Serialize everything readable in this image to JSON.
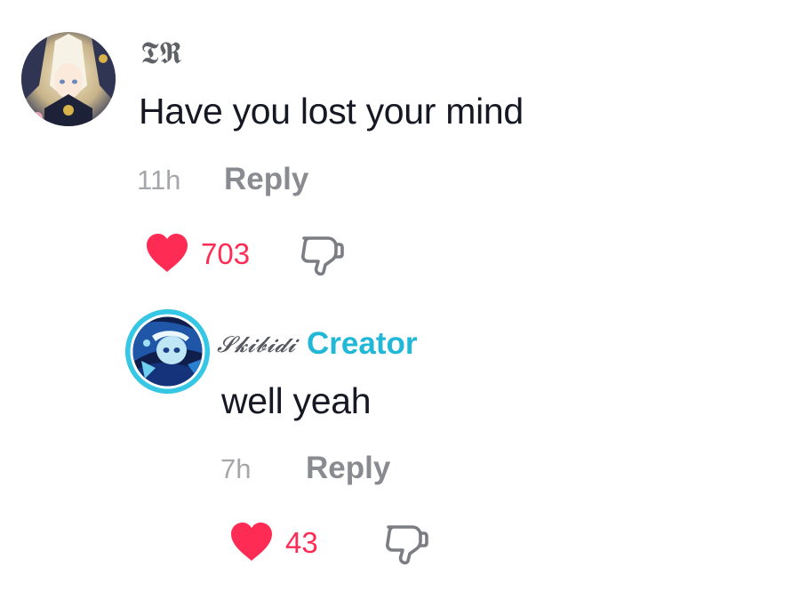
{
  "comments": [
    {
      "username": "𝕿𝕽",
      "text": "Have you lost your mind",
      "time": "11h",
      "reply_label": "Reply",
      "likes": "703",
      "liked": true
    }
  ],
  "reply": {
    "username": "𝓢𝓴𝓲𝓫𝓲𝓭𝓲",
    "badge": "Creator",
    "text": "well yeah",
    "time": "7h",
    "reply_label": "Reply",
    "likes": "43",
    "liked": true
  },
  "colors": {
    "like": "#fe2c55",
    "creator_badge": "#20b8d6",
    "creator_ring": "#2ec4e0",
    "text": "#161823",
    "muted": "#a6a7ab"
  },
  "icons": {
    "like": "heart-icon",
    "dislike": "thumbs-down-icon"
  }
}
